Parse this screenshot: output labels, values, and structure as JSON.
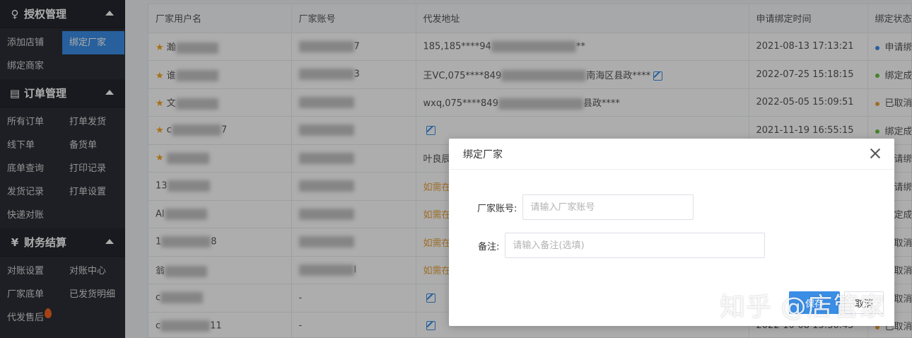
{
  "sidebar": {
    "sections": [
      {
        "title": "授权管理",
        "icon": "user-key-icon",
        "items": [
          {
            "label": "添加店铺",
            "active": false
          },
          {
            "label": "绑定厂家",
            "active": true
          },
          {
            "label": "绑定商家",
            "active": false
          }
        ]
      },
      {
        "title": "订单管理",
        "icon": "order-list-icon",
        "items": [
          {
            "label": "所有订单"
          },
          {
            "label": "打单发货"
          },
          {
            "label": "线下单"
          },
          {
            "label": "备货单"
          },
          {
            "label": "底单查询"
          },
          {
            "label": "打印记录"
          },
          {
            "label": "发货记录"
          },
          {
            "label": "打单设置"
          },
          {
            "label": "快递对账"
          }
        ]
      },
      {
        "title": "财务结算",
        "icon": "yen-icon",
        "items": [
          {
            "label": "对账设置"
          },
          {
            "label": "对账中心"
          },
          {
            "label": "厂家底单"
          },
          {
            "label": "已发货明细"
          },
          {
            "label": "代发售后"
          }
        ]
      }
    ]
  },
  "table": {
    "columns": [
      "厂家用户名",
      "厂家账号",
      "代发地址",
      "申请绑定时间",
      "绑定状态"
    ],
    "rows": [
      {
        "starred": true,
        "name": "瀚",
        "account": "7",
        "address": "185,185****94",
        "address_tail": "**",
        "address_edit": false,
        "time": "2021-08-13 17:13:21",
        "status": "申请绑",
        "status_color": "#3a8ee6"
      },
      {
        "starred": true,
        "name": "谁",
        "account": "3",
        "address": "王VC,075****849",
        "address_tail": "南海区县政****",
        "address_edit": true,
        "time": "2022-07-25 15:18:15",
        "status": "绑定成",
        "status_color": "#67c23a"
      },
      {
        "starred": true,
        "name": "文",
        "account": "",
        "address": "wxq,075****849",
        "address_tail": "县政****",
        "address_edit": false,
        "time": "2022-05-05 15:09:51",
        "status": "已取消",
        "status_color": "#e6a23c"
      },
      {
        "starred": true,
        "name": "c",
        "name_tail": "7",
        "account": "",
        "address": "",
        "address_tail": "",
        "address_edit": true,
        "time": "2021-11-19 16:55:15",
        "status": "绑定成",
        "status_color": "#67c23a"
      },
      {
        "starred": true,
        "name": "",
        "account": "",
        "address": "叶良辰",
        "address_tail": "",
        "address_edit": false,
        "time": "",
        "status": "申请绑",
        "status_color": "#3a8ee6"
      },
      {
        "starred": false,
        "name": "13",
        "account": "",
        "address": "如需在",
        "address_tail": "",
        "address_edit": false,
        "orange": true,
        "time": "",
        "status": "申请绑",
        "status_color": "#3a8ee6"
      },
      {
        "starred": false,
        "name": "Al",
        "account": "",
        "address": "如需在",
        "address_tail": "",
        "address_edit": false,
        "orange": true,
        "time": "",
        "status": "绑定成",
        "status_color": "#67c23a"
      },
      {
        "starred": false,
        "name": "1",
        "name_tail": "8",
        "account": "",
        "address": "如需在",
        "address_tail": "",
        "address_edit": false,
        "orange": true,
        "time": "",
        "status": "已取消",
        "status_color": "#e6a23c"
      },
      {
        "starred": false,
        "name": "翁",
        "account": "l",
        "address": "如需在",
        "address_tail": "",
        "address_edit": false,
        "orange": true,
        "time": "",
        "status": "已取消",
        "status_color": "#e6a23c"
      },
      {
        "starred": false,
        "name": "c",
        "account": "-",
        "address": "",
        "address_tail": "",
        "address_edit": true,
        "time": "",
        "status": "已取消",
        "status_color": "#e6a23c"
      },
      {
        "starred": false,
        "name": "c",
        "name_tail": "11",
        "account": "-",
        "address": "",
        "address_tail": "",
        "address_edit": true,
        "time": "2022-10-08 15:36:45",
        "status": "已取消",
        "status_color": "#e6a23c"
      }
    ]
  },
  "modal": {
    "title": "绑定厂家",
    "account_label": "厂家账号:",
    "account_placeholder": "请输入厂家账号",
    "remark_label": "备注:",
    "remark_placeholder": "请输入备注(选填)",
    "save_label": "保存",
    "cancel_label": "取消"
  },
  "watermark": "知乎 @店管家",
  "colors": {
    "accent": "#3a8ee6",
    "sidebar_bg": "#2b2e36",
    "star": "#f5a524",
    "warning_text": "#e6a23c"
  }
}
